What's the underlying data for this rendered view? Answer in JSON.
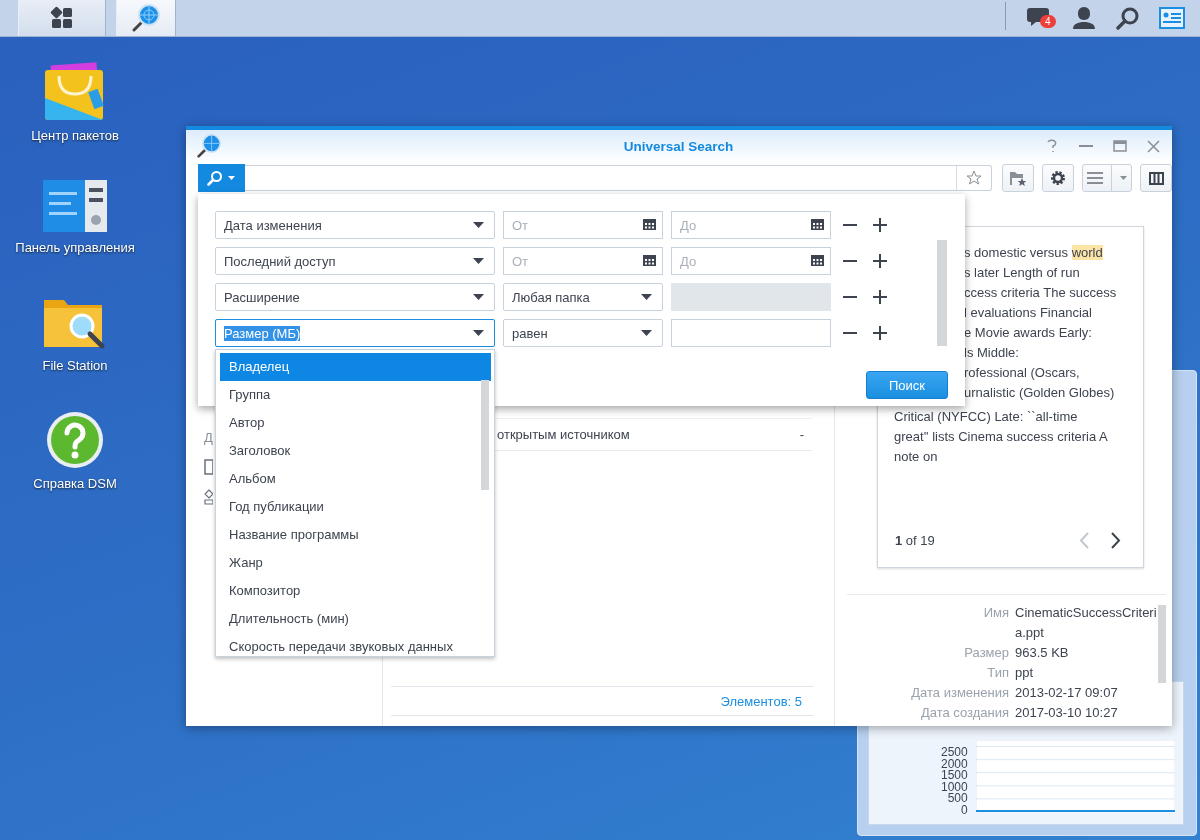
{
  "taskbar": {
    "notification_count": "4"
  },
  "desktop_icons": [
    {
      "label": "Центр пакетов",
      "kind": "package"
    },
    {
      "label": "Панель управления",
      "kind": "control"
    },
    {
      "label": "File Station",
      "kind": "files"
    },
    {
      "label": "Справка DSM",
      "kind": "help"
    }
  ],
  "window": {
    "title": "Universal Search"
  },
  "filters": [
    {
      "kind": "date",
      "criterion": "Дата изменения",
      "focused": false,
      "from_placeholder": "От",
      "to_placeholder": "До"
    },
    {
      "kind": "date",
      "criterion": "Последний доступ",
      "focused": false,
      "from_placeholder": "От",
      "to_placeholder": "До"
    },
    {
      "kind": "select",
      "criterion": "Расширение",
      "focused": false,
      "option": "Любая папка",
      "value_disabled": true
    },
    {
      "kind": "select",
      "criterion": "Размер (МБ)",
      "focused": true,
      "option": "равен",
      "value_disabled": false
    }
  ],
  "search_button": "Поиск",
  "criterion_menu": [
    {
      "label": "Владелец",
      "selected": true
    },
    {
      "label": "Группа",
      "selected": false
    },
    {
      "label": "Автор",
      "selected": false
    },
    {
      "label": "Заголовок",
      "selected": false
    },
    {
      "label": "Альбом",
      "selected": false
    },
    {
      "label": "Год публикации",
      "selected": false
    },
    {
      "label": "Название программы",
      "selected": false
    },
    {
      "label": "Жанр",
      "selected": false
    },
    {
      "label": "Композитор",
      "selected": false
    },
    {
      "label": "Длительность (мин)",
      "selected": false
    },
    {
      "label": "Скорость передачи звуковых данных",
      "selected": false
    }
  ],
  "sidebar": {
    "label_fragment": "Д"
  },
  "results": {
    "rows": [
      {
        "name": "открытым источником",
        "column_2": "-"
      }
    ],
    "footer": "Элементов: 5"
  },
  "preview": {
    "partial_lines": [
      {
        "segments": [
          {
            "text": "s domestic versus ",
            "highlighted": false
          },
          {
            "text": "world",
            "highlighted": true
          }
        ]
      },
      {
        "segments": [
          {
            "text": "s later Length of run",
            "highlighted": false
          }
        ]
      },
      {
        "segments": [
          {
            "text": "ccess criteria The success",
            "highlighted": false
          }
        ]
      },
      {
        "segments": [
          {
            "text": "l evaluations Financial",
            "highlighted": false
          }
        ]
      },
      {
        "segments": [
          {
            "text": "e Movie awards Early:",
            "highlighted": false
          }
        ]
      },
      {
        "segments": [
          {
            "text": "ls Middle:",
            "highlighted": false
          }
        ]
      },
      {
        "segments": [
          {
            "text": "rofessional (Oscars,",
            "highlighted": false
          }
        ]
      },
      {
        "segments": [
          {
            "text": "urnalistic (Golden Globes)",
            "highlighted": false
          }
        ]
      }
    ],
    "lines": [
      {
        "segments": [
          {
            "text": "Critical (NYFCC) Late: ``all-time",
            "highlighted": false
          }
        ]
      },
      {
        "segments": [
          {
            "text": "great'' lists Cinema success criteria A",
            "highlighted": false
          }
        ]
      },
      {
        "segments": [
          {
            "text": "note on",
            "highlighted": false
          }
        ]
      }
    ],
    "pager": "**1** of 19"
  },
  "details": [
    {
      "label": "Имя",
      "value": "CinematicSuccessCriteria.ppt"
    },
    {
      "label": "Размер",
      "value": "963.5 KB"
    },
    {
      "label": "Тип",
      "value": "ppt"
    },
    {
      "label": "Дата изменения",
      "value": "2013-02-17 09:07"
    },
    {
      "label": "Дата создания",
      "value": "2017-03-10 10:27"
    }
  ],
  "widget": {
    "chart_data": {
      "type": "line",
      "grid": true,
      "yticks": [
        0,
        500,
        1000,
        1500,
        2000,
        2500
      ],
      "ylim": [
        0,
        2750
      ],
      "series": [
        {
          "color": "#1a8fe0",
          "values": [
            0,
            0,
            0,
            0,
            0,
            0
          ]
        }
      ]
    }
  }
}
